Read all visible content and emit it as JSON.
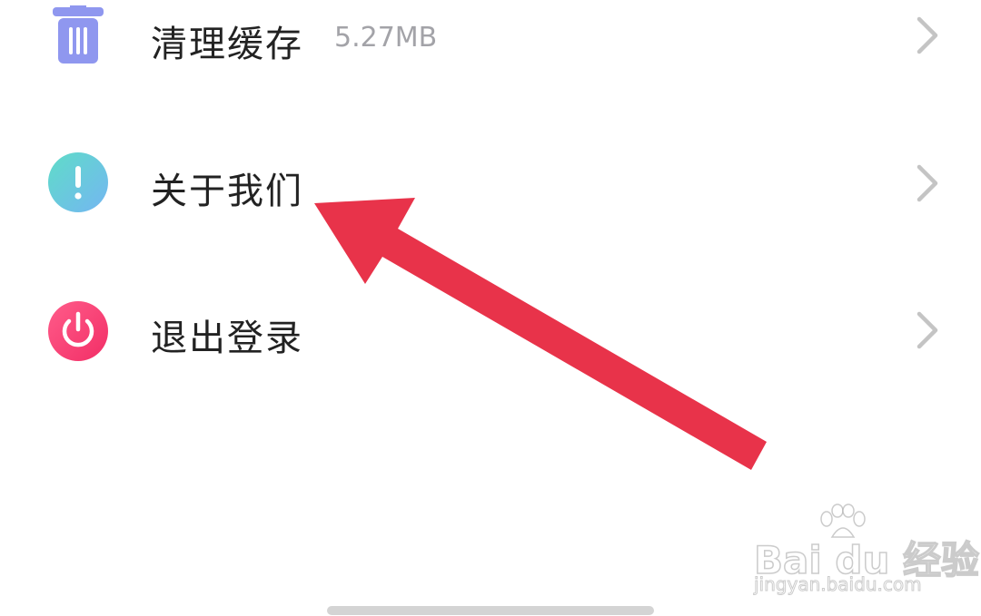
{
  "menu": {
    "items": [
      {
        "label": "清理缓存",
        "detail": "5.27MB",
        "icon": "trash-icon"
      },
      {
        "label": "关于我们",
        "icon": "info-exclamation-icon"
      },
      {
        "label": "退出登录",
        "icon": "power-icon"
      }
    ]
  },
  "annotation": {
    "arrow_color": "#e8334a"
  },
  "watermark": {
    "brand": "Bai du 经验",
    "url": "jingyan.baidu.com"
  },
  "colors": {
    "trash": "#8f97ef",
    "info_from": "#5fdcc8",
    "info_to": "#74b6f2",
    "power_from": "#ff5c8a",
    "power_to": "#f22e66",
    "chevron": "#c4c4c4"
  }
}
